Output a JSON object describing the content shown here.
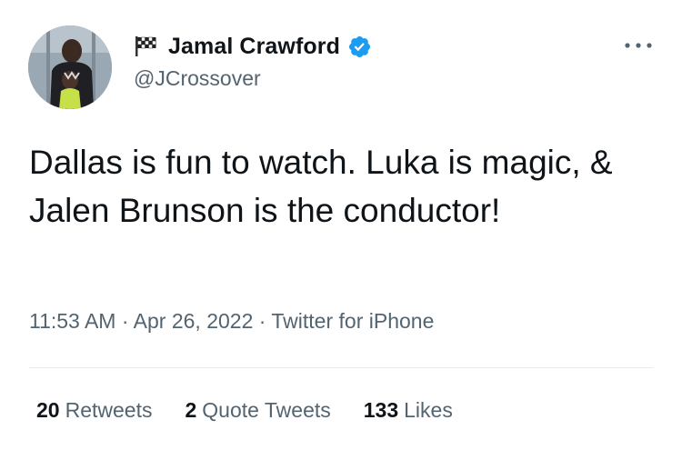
{
  "author": {
    "display_name": "Jamal Crawford",
    "handle": "@JCrossover",
    "verified": true,
    "name_prefix_icon": "checkered-flag-icon"
  },
  "tweet": {
    "text": "Dallas is fun to watch. Luka is magic, & Jalen Brunson is the conductor!",
    "time": "11:53 AM",
    "date": "Apr 26, 2022",
    "source": "Twitter for iPhone",
    "separator": "·"
  },
  "stats": {
    "retweets": {
      "count": "20",
      "label": "Retweets"
    },
    "quote_tweets": {
      "count": "2",
      "label": "Quote Tweets"
    },
    "likes": {
      "count": "133",
      "label": "Likes"
    }
  },
  "colors": {
    "text_primary": "#0f1419",
    "text_secondary": "#536471",
    "verified_blue": "#1d9bf0",
    "divider": "#e6ecf0"
  }
}
